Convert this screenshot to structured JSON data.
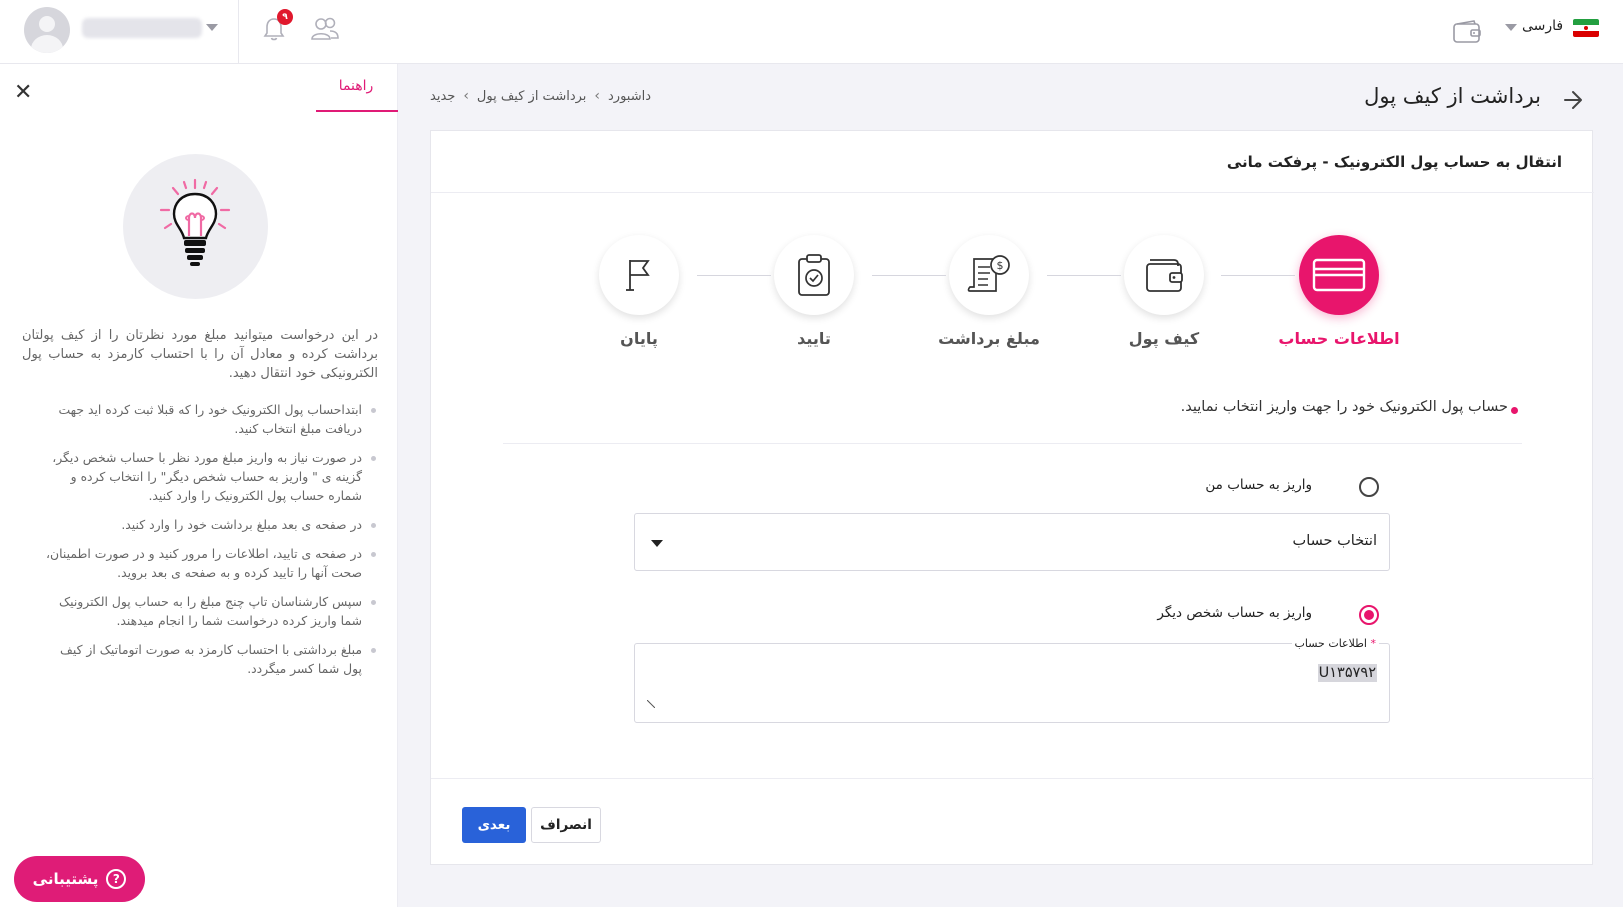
{
  "topbar": {
    "username": "username",
    "notifications_count": "۹",
    "language": "فارسی"
  },
  "guide": {
    "tab_label": "راهنما",
    "intro": "در این درخواست میتوانید مبلغ مورد نظرتان را از کیف پولتان برداشت کرده و معادل آن را با احتساب کارمزد به حساب پول الکترونیکی خود انتقال دهید.",
    "items": [
      "ابتداحساب پول الکترونیک خود را که قبلا ثبت کرده اید جهت دریافت مبلغ انتخاب کنید.",
      "در صورت نیاز به واریز مبلغ مورد نظر با حساب شخص دیگر، گزینه ی \" واریز به حساب شخص دیگر\" را انتخاب کرده و شماره حساب پول الکترونیک را وارد کنید.",
      "در صفحه ی بعد مبلغ برداشت خود را وارد کنید.",
      "در صفحه ی تایید، اطلاعات را مرور کنید و در صورت اطمینان، صحت آنها را تایید کرده و به صفحه ی بعد بروید.",
      "سپس کارشناسان تاپ چنج مبلغ را به حساب پول الکترونیک شما واریز کرده درخواست شما را انجام میدهند.",
      "مبلغ برداشتی با احتساب کارمزد به صورت اتوماتیک از کیف پول شما کسر میگردد."
    ],
    "support_label": "پشتیبانی"
  },
  "page": {
    "title": "برداشت از کیف پول",
    "breadcrumb": [
      "داشبورد",
      "برداشت از کیف پول",
      "جدید"
    ]
  },
  "card": {
    "title": "انتقال به حساب پول الکترونیک - پرفکت مانی",
    "steps": [
      {
        "label": "اطلاعات حساب",
        "icon": "card-icon",
        "active": true
      },
      {
        "label": "کیف پول",
        "icon": "wallet-icon",
        "active": false
      },
      {
        "label": "مبلغ برداشت",
        "icon": "invoice-icon",
        "active": false
      },
      {
        "label": "تایید",
        "icon": "clipboard-check-icon",
        "active": false
      },
      {
        "label": "پایان",
        "icon": "flag-icon",
        "active": false
      }
    ],
    "instruction": "حساب پول الکترونیک خود را جهت واریز انتخاب نمایید.",
    "option_my_account": "واریز به حساب من",
    "select_placeholder": "انتخاب حساب",
    "option_other_account": "واریز به حساب شخص دیگر",
    "account_info_label": "اطلاعات حساب",
    "account_info_value": "U۱۳۵۷۹۲",
    "next_label": "بعدی",
    "cancel_label": "انصراف"
  },
  "colors": {
    "accent": "#e8156c",
    "primary_button": "#2962d9"
  }
}
